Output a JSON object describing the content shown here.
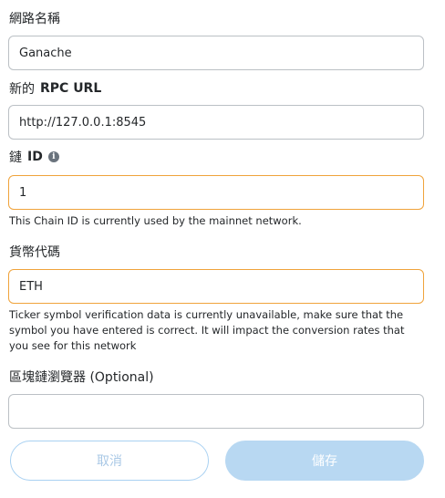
{
  "network_name": {
    "label": "網路名稱",
    "value": "Ganache"
  },
  "rpc_url": {
    "label_prefix": "新的",
    "label_strong": "RPC URL",
    "value": "http://127.0.0.1:8545"
  },
  "chain_id": {
    "label_prefix": "鏈",
    "label_strong": "ID",
    "info_icon": "i",
    "value": "1",
    "note": "This Chain ID is currently used by the mainnet network."
  },
  "currency_symbol": {
    "label": "貨幣代碼",
    "value": "ETH",
    "note": "Ticker symbol verification data is currently unavailable, make sure that the symbol you have entered is correct. It will impact the conversion rates that you see for this network"
  },
  "block_explorer": {
    "label": "區塊鏈瀏覽器 (Optional)",
    "value": ""
  },
  "actions": {
    "cancel_label": "取消",
    "save_label": "儲存"
  },
  "colors": {
    "warning_border": "#f0a33b",
    "default_border": "#bbc0c5",
    "primary_disabled": "#b8d8f2"
  }
}
